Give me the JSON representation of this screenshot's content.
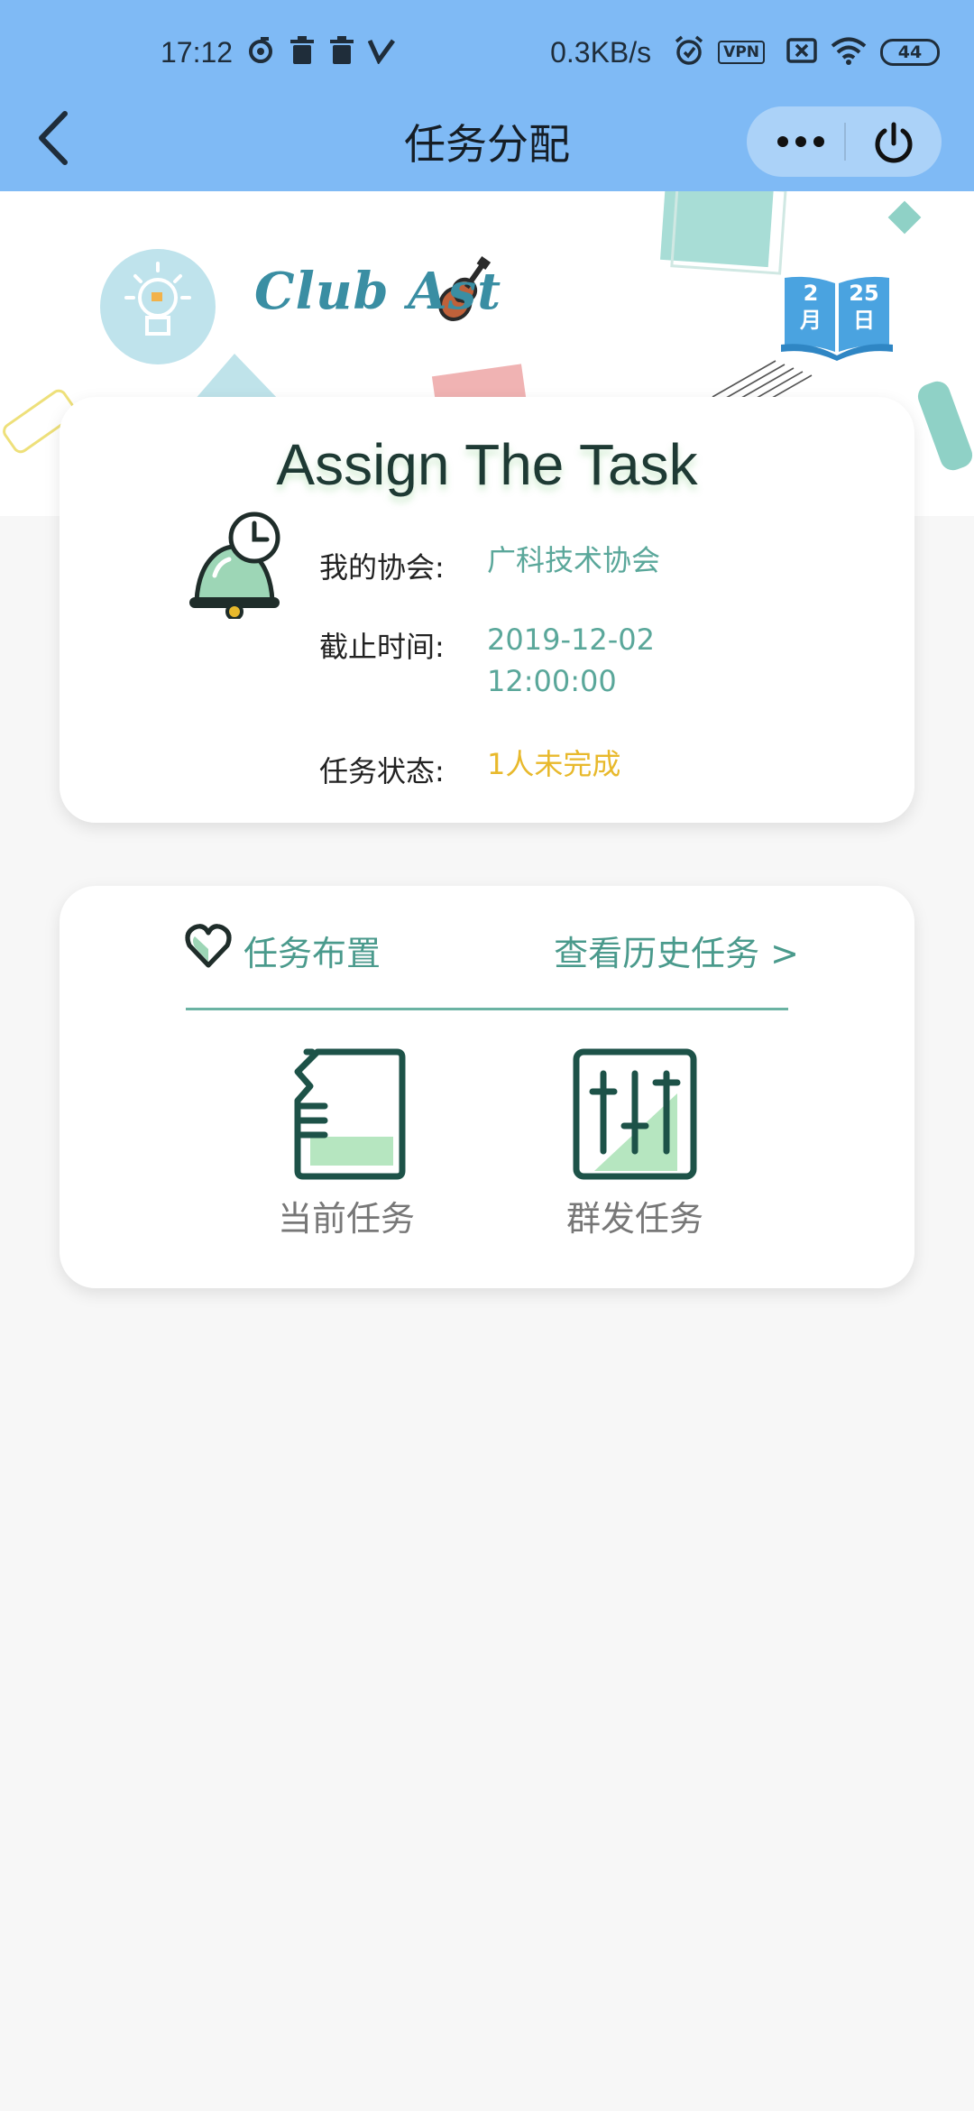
{
  "status_bar": {
    "time": "17:12",
    "speed": "0.3KB/s",
    "vpn": "VPN",
    "battery": "44"
  },
  "nav": {
    "title": "任务分配"
  },
  "banner": {
    "club_logo_text": "Club Ast",
    "calendar_month": "2",
    "calendar_month_unit": "月",
    "calendar_day": "25",
    "calendar_day_unit": "日"
  },
  "task_card": {
    "heading": "Assign The Task",
    "rows": [
      {
        "label": "我的协会:",
        "value": "广科技术协会"
      },
      {
        "label": "截止时间:",
        "value_line1": "2019-12-02",
        "value_line2": "12:00:00"
      },
      {
        "label": "任务状态:",
        "value": "1人未完成"
      }
    ]
  },
  "task_section": {
    "title": "任务布置",
    "history_link": "查看历史任务 >",
    "tiles": [
      {
        "label": "当前任务",
        "icon": "document-icon"
      },
      {
        "label": "群发任务",
        "icon": "sliders-icon"
      }
    ]
  },
  "colors": {
    "nav_bg": "#7fbaf5",
    "accent_green": "#5aa79a",
    "warning": "#e8b92c",
    "page_bg": "#f7f7f7"
  }
}
